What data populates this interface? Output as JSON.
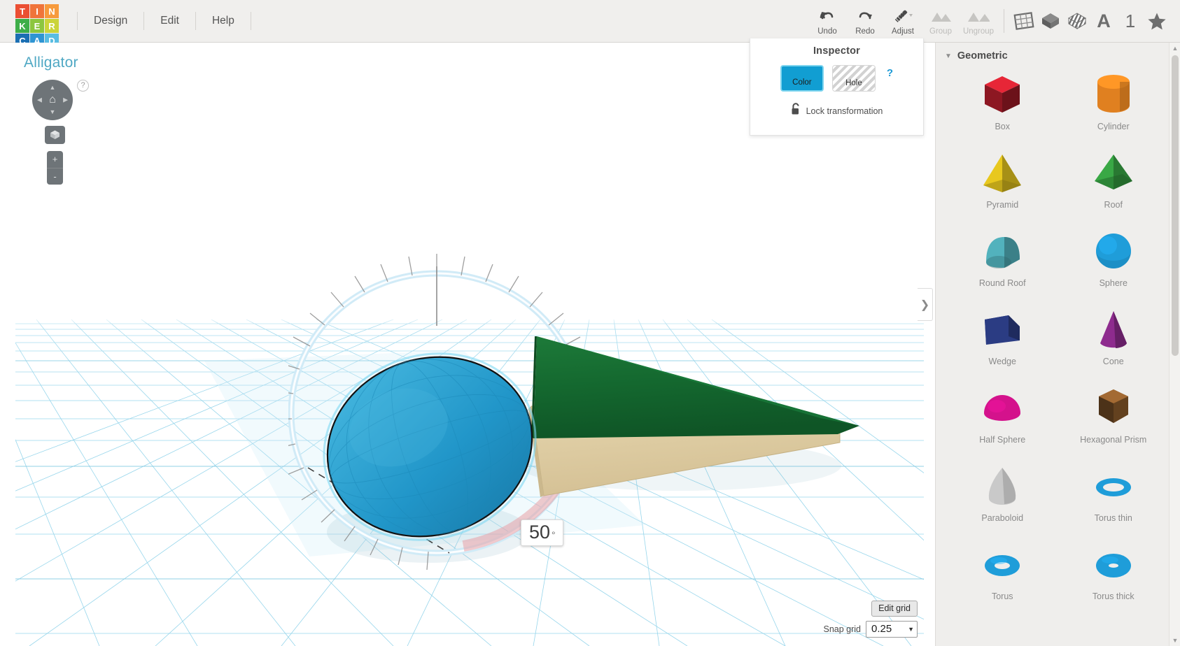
{
  "app": {
    "logo_tiles": [
      {
        "letter": "T",
        "color": "#eb4f33"
      },
      {
        "letter": "I",
        "color": "#f0743a"
      },
      {
        "letter": "N",
        "color": "#f79a3c"
      },
      {
        "letter": "K",
        "color": "#3eae49"
      },
      {
        "letter": "E",
        "color": "#8cc63f"
      },
      {
        "letter": "R",
        "color": "#cbd43a"
      },
      {
        "letter": "C",
        "color": "#1b6fb3"
      },
      {
        "letter": "A",
        "color": "#2f95d3"
      },
      {
        "letter": "D",
        "color": "#59bde2"
      }
    ]
  },
  "menu": {
    "items": [
      {
        "label": "Design"
      },
      {
        "label": "Edit"
      },
      {
        "label": "Help"
      }
    ]
  },
  "toolbar": {
    "undo_label": "Undo",
    "redo_label": "Redo",
    "adjust_label": "Adjust",
    "group_label": "Group",
    "ungroup_label": "Ungroup",
    "workplane_icon": "workplane-icon",
    "solid_view_icon": "solid-view-icon",
    "transparent_view_icon": "transparent-view-icon",
    "text_icon": "A",
    "number_icon": "1",
    "star_icon": "★"
  },
  "viewport": {
    "design_name": "Alligator",
    "help_badge": "?",
    "home_icon": "home-icon",
    "fit_icon": "fit-to-view-icon",
    "zoom_in": "+",
    "zoom_out": "-",
    "rotation": {
      "angle_value": "50",
      "angle_unit": "°"
    },
    "grid": {
      "edit_grid_label": "Edit grid",
      "snap_grid_label": "Snap grid",
      "snap_grid_value": "0.25",
      "caret": "▼"
    },
    "collapse_handle": "❯",
    "shapes": [
      {
        "name": "sphere-shape",
        "color": "#2196c9"
      },
      {
        "name": "cone-shape",
        "color": "#14682f"
      },
      {
        "name": "wedge-shape",
        "color": "#ddcba0"
      }
    ]
  },
  "inspector": {
    "title": "Inspector",
    "color_label": "Color",
    "color_value": "#119ed2",
    "hole_label": "Hole",
    "help_badge": "?",
    "lock_label": "Lock transformation",
    "lock_icon": "unlocked-padlock-icon"
  },
  "library": {
    "caret": "▼",
    "category": "Geometric",
    "shapes": [
      {
        "label": "Box",
        "icon": "box-icon",
        "color": "#c4202f"
      },
      {
        "label": "Cylinder",
        "icon": "cylinder-icon",
        "color": "#e08020"
      },
      {
        "label": "Pyramid",
        "icon": "pyramid-icon",
        "color": "#e8c81e"
      },
      {
        "label": "Roof",
        "icon": "roof-icon",
        "color": "#39a845"
      },
      {
        "label": "Round Roof",
        "icon": "round-roof-icon",
        "color": "#52b2bd"
      },
      {
        "label": "Sphere",
        "icon": "sphere-icon",
        "color": "#1f9dd9"
      },
      {
        "label": "Wedge",
        "icon": "wedge-icon",
        "color": "#2b3c83"
      },
      {
        "label": "Cone",
        "icon": "cone-icon",
        "color": "#8e2b8e"
      },
      {
        "label": "Half Sphere",
        "icon": "half-sphere-icon",
        "color": "#d4128c"
      },
      {
        "label": "Hexagonal Prism",
        "icon": "hexagonal-prism-icon",
        "color": "#8a5a2b"
      },
      {
        "label": "Paraboloid",
        "icon": "paraboloid-icon",
        "color": "#c9c9c9"
      },
      {
        "label": "Torus thin",
        "icon": "torus-thin-icon",
        "color": "#1f9dd9"
      },
      {
        "label": "Torus",
        "icon": "torus-icon",
        "color": "#1f9dd9"
      },
      {
        "label": "Torus thick",
        "icon": "torus-thick-icon",
        "color": "#1f9dd9"
      }
    ]
  },
  "scrollbar": {
    "up_arrow": "▲",
    "down_arrow": "▼"
  }
}
